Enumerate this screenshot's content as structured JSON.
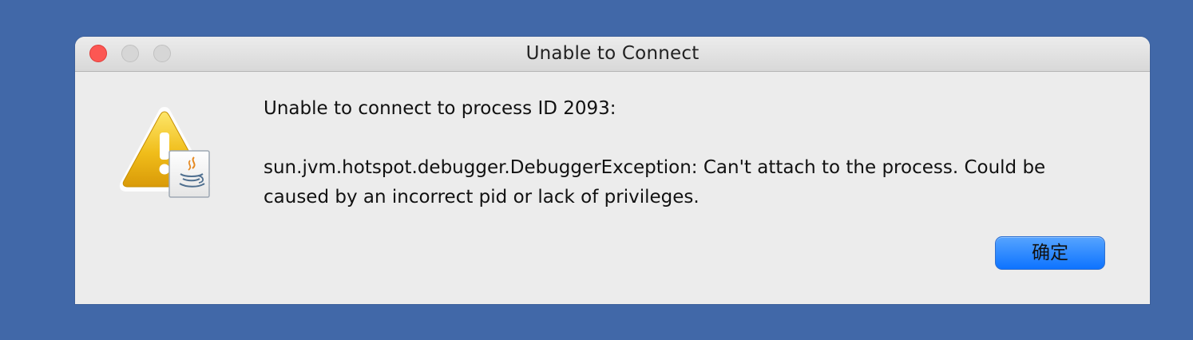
{
  "window": {
    "title": "Unable to Connect"
  },
  "dialog": {
    "message_line_1": "Unable to connect to process ID 2093:",
    "message_line_2": "sun.jvm.hotspot.debugger.DebuggerException: Can't attach to the process. Could be",
    "message_line_3": "caused by an incorrect pid or lack of privileges.",
    "icon": "warning-java-icon",
    "ok_label": "确定"
  },
  "colors": {
    "desktop": "#4168a8",
    "window_bg": "#ececec",
    "close_button": "#fc5753",
    "accent": "#0d73ff",
    "warning": "#f2b600"
  }
}
